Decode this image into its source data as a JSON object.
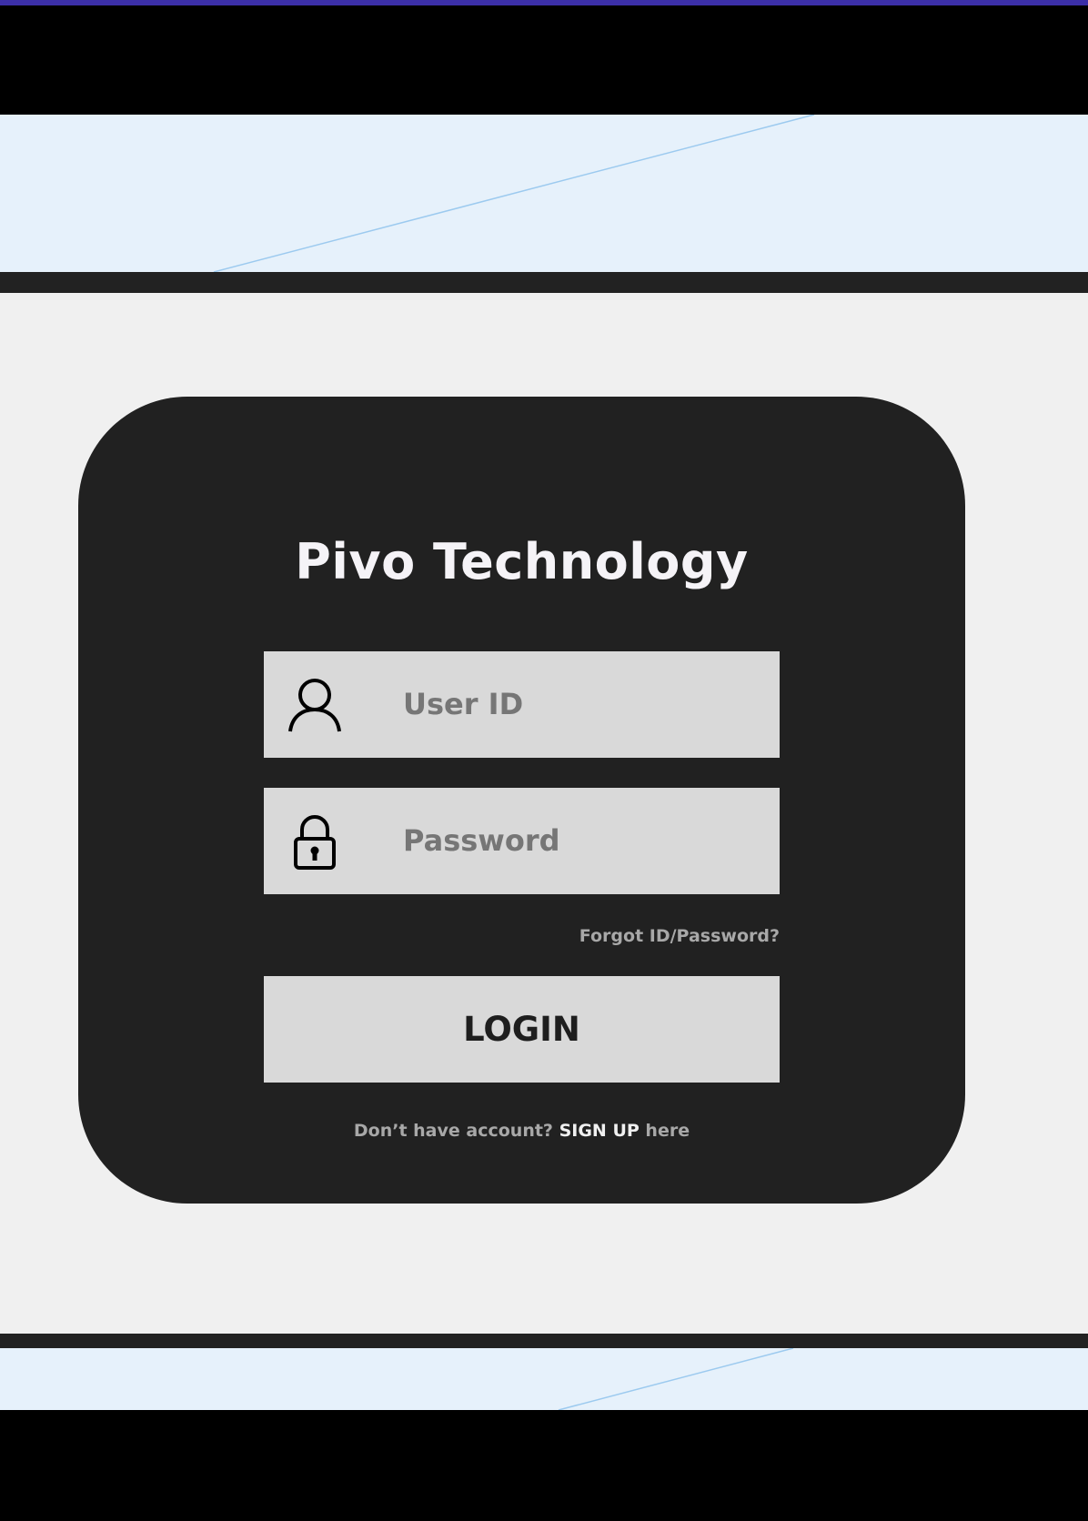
{
  "brand": {
    "title": "Pivo Technology"
  },
  "form": {
    "user_id": {
      "placeholder": "User ID",
      "icon": "user-icon"
    },
    "password": {
      "placeholder": "Password",
      "icon": "lock-icon"
    },
    "forgot_link": "Forgot ID/Password?",
    "login_label": "LOGIN",
    "signup": {
      "prefix": "Don’t have account?",
      "link": "SIGN UP",
      "suffix": "here"
    }
  },
  "colors": {
    "card": "#212121",
    "input": "#d9d9d9",
    "page_bg": "#f0f0f0",
    "band": "#e6f1fb",
    "accent": "#3b2fa8"
  }
}
